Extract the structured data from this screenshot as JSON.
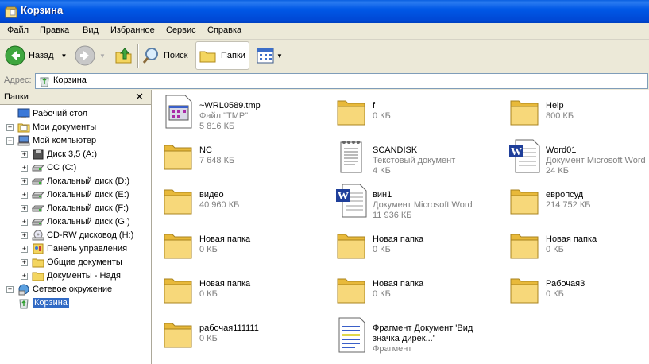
{
  "window": {
    "title": "Корзина"
  },
  "menu": [
    "Файл",
    "Правка",
    "Вид",
    "Избранное",
    "Сервис",
    "Справка"
  ],
  "toolbar": {
    "back_label": "Назад",
    "search_label": "Поиск",
    "folders_label": "Папки"
  },
  "address": {
    "label": "Адрес:",
    "value": "Корзина"
  },
  "folders_pane": {
    "title": "Папки",
    "close": "✕",
    "tree": [
      {
        "label": "Рабочий стол",
        "icon": "desktop-icon"
      },
      {
        "label": "Мои документы",
        "icon": "my-documents-icon",
        "toggle": "+"
      },
      {
        "label": "Мой компьютер",
        "icon": "my-computer-icon",
        "toggle": "−"
      },
      {
        "label": "Диск 3,5 (A:)",
        "icon": "floppy-icon",
        "toggle": "+"
      },
      {
        "label": "CC (C:)",
        "icon": "drive-icon",
        "toggle": "+"
      },
      {
        "label": "Локальный диск (D:)",
        "icon": "drive-icon",
        "toggle": "+"
      },
      {
        "label": "Локальный диск (E:)",
        "icon": "drive-icon",
        "toggle": "+"
      },
      {
        "label": "Локальный диск (F:)",
        "icon": "drive-icon",
        "toggle": "+"
      },
      {
        "label": "Локальный диск (G:)",
        "icon": "drive-icon",
        "toggle": "+"
      },
      {
        "label": "CD-RW дисковод (H:)",
        "icon": "cd-drive-icon",
        "toggle": "+"
      },
      {
        "label": "Панель управления",
        "icon": "control-panel-icon",
        "toggle": "+"
      },
      {
        "label": "Общие документы",
        "icon": "folder-icon",
        "toggle": "+"
      },
      {
        "label": "Документы - Надя",
        "icon": "folder-icon",
        "toggle": "+"
      },
      {
        "label": "Сетевое окружение",
        "icon": "network-icon",
        "toggle": "+"
      },
      {
        "label": "Корзина",
        "icon": "recycle-bin-icon"
      }
    ]
  },
  "items": [
    {
      "name": "~WRL0589.tmp",
      "line2": "Файл \"TMP\"",
      "line3": "5 816 КБ",
      "icon": "tmp-file-icon"
    },
    {
      "name": "f",
      "line2": "0 КБ",
      "icon": "folder-icon"
    },
    {
      "name": "Help",
      "line2": "800 КБ",
      "icon": "folder-icon"
    },
    {
      "name": "NC",
      "line2": "7 648 КБ",
      "icon": "folder-icon"
    },
    {
      "name": "SCANDISK",
      "line2": "Текстовый документ",
      "line3": "4 КБ",
      "icon": "text-document-icon"
    },
    {
      "name": "Word01",
      "line2": "Документ Microsoft Word",
      "line3": "24 КБ",
      "icon": "word-document-icon"
    },
    {
      "name": "видео",
      "line2": "40 960 КБ",
      "icon": "folder-icon"
    },
    {
      "name": "вин1",
      "line2": "Документ Microsoft Word",
      "line3": "11 936 КБ",
      "icon": "word-document-icon"
    },
    {
      "name": "европсуд",
      "line2": "214 752 КБ",
      "icon": "folder-icon"
    },
    {
      "name": "Новая папка",
      "line2": "0 КБ",
      "icon": "folder-icon"
    },
    {
      "name": "Новая папка",
      "line2": "0 КБ",
      "icon": "folder-icon"
    },
    {
      "name": "Новая папка",
      "line2": "0 КБ",
      "icon": "folder-icon"
    },
    {
      "name": "Новая папка",
      "line2": "0 КБ",
      "icon": "folder-icon"
    },
    {
      "name": "Новая папка",
      "line2": "0 КБ",
      "icon": "folder-icon"
    },
    {
      "name": "Рабочая3",
      "line2": "0 КБ",
      "icon": "folder-icon"
    },
    {
      "name": "рабочая111111",
      "line2": "0 КБ",
      "icon": "folder-icon"
    },
    {
      "name": "Фрагмент Документ 'Вид",
      "line2": "значка дирек...'",
      "line3": "Фрагмент",
      "icon": "scrap-document-icon"
    }
  ],
  "colors": {
    "titlebar": "#0054e3",
    "chrome": "#ece9d8",
    "selection": "#316ac5"
  }
}
